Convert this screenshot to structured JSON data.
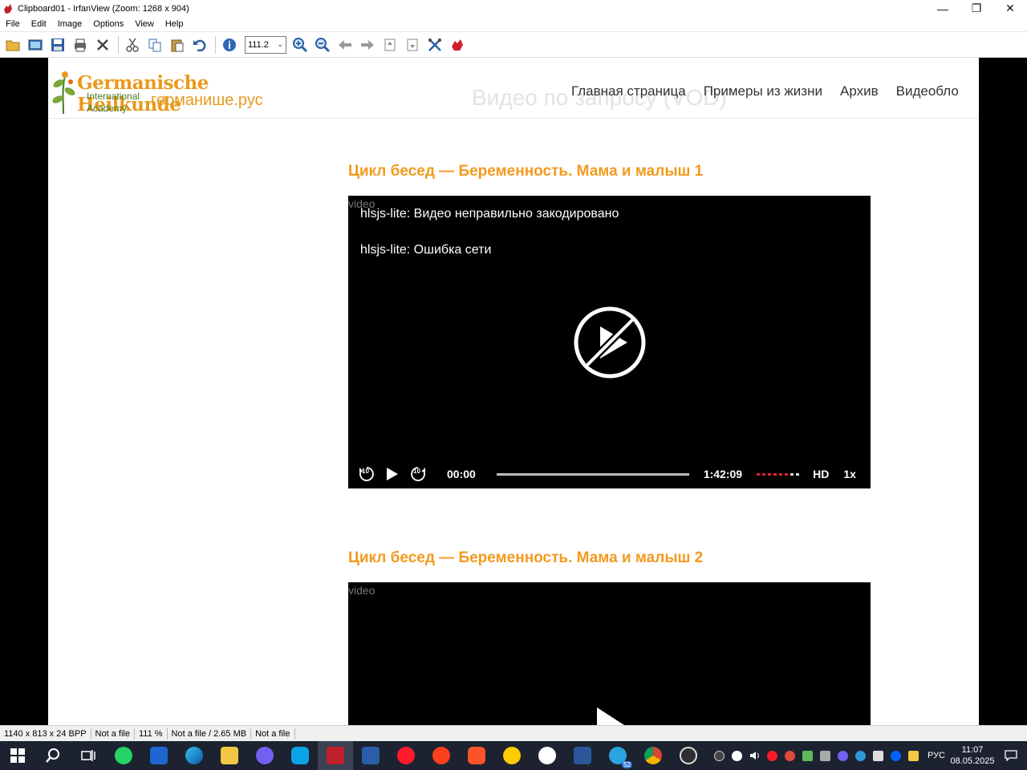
{
  "window": {
    "title": "Clipboard01 - IrfanView (Zoom: 1268 x 904)",
    "minimize": "—",
    "restore": "❐",
    "close": "✕"
  },
  "menu": [
    "File",
    "Edit",
    "Image",
    "Options",
    "View",
    "Help"
  ],
  "toolbar": {
    "zoom_value": "111.2",
    "icons": [
      "open-icon",
      "slideshow-icon",
      "save-icon",
      "print-icon",
      "delete-icon",
      "cut-icon",
      "copy-icon",
      "paste-icon",
      "undo-icon",
      "info-icon",
      "zoom-in-icon",
      "zoom-out-icon",
      "previous-icon",
      "next-icon",
      "first-icon",
      "last-icon",
      "settings-icon",
      "irfanview-icon"
    ]
  },
  "site": {
    "logo_title": "Germanische Heilkunde",
    "logo_sub1": "International",
    "logo_sub2": "Academy",
    "logo_ru": "германише.рус",
    "vod_heading": "Видео по запросу (VOD)",
    "nav": [
      "Главная страница",
      "Примеры из жизни",
      "Архив",
      "Видеобло"
    ]
  },
  "videos": [
    {
      "title": "Цикл бесед — Беременность. Мама и малыш 1",
      "alt": "video",
      "errors": [
        "hlsjs-lite: Видео неправильно закодировано",
        "hlsjs-lite: Ошибка сети"
      ],
      "controls": {
        "rewind_label": "10",
        "forward_label": "10",
        "current_time": "00:00",
        "duration": "1:42:09",
        "quality": "HD",
        "speed": "1x"
      }
    },
    {
      "title": "Цикл бесед — Беременность. Мама и малыш 2",
      "alt": "video"
    }
  ],
  "statusbar": [
    "1140 x 813 x 24 BPP",
    "Not a file",
    "111 %",
    "Not a file / 2.65 MB",
    "Not a file"
  ],
  "taskbar": {
    "apps": [
      "windows-start-icon",
      "search-icon",
      "task-view-icon",
      "whatsapp-icon",
      "app-grid-icon",
      "edge-icon",
      "file-explorer-icon",
      "viber-icon",
      "skype-icon",
      "irfanview-icon",
      "calculator-icon",
      "opera-icon",
      "yandex-icon",
      "brave-icon",
      "yandex-market-icon",
      "yandex-browser-icon",
      "word-icon",
      "telegram-icon",
      "chrome-icon",
      "obs-icon"
    ],
    "language": "РУС",
    "time": "11:07",
    "date": "08.05.2025",
    "telegram_badge": "52"
  }
}
